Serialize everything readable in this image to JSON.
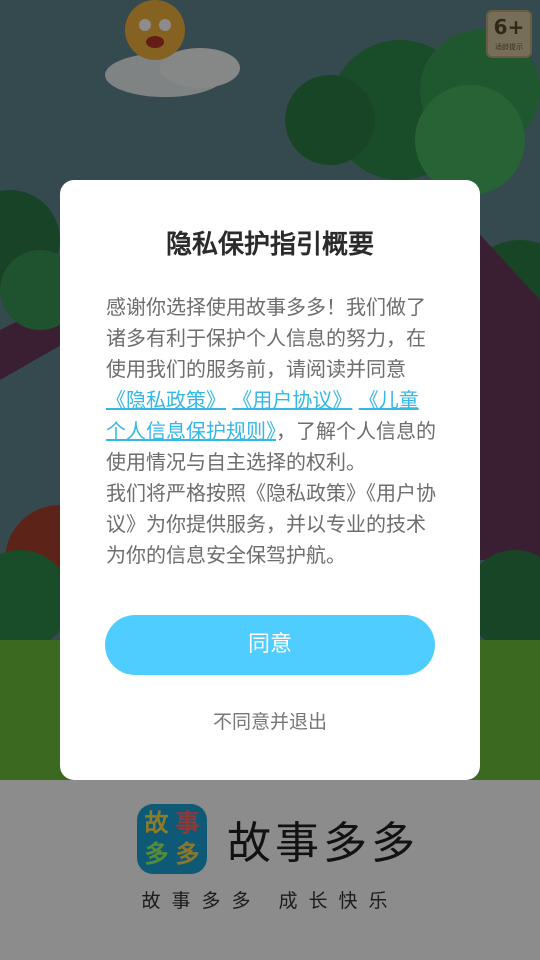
{
  "age_rating": {
    "label": "6+",
    "sub": "适龄提示"
  },
  "dialog": {
    "title": "隐私保护指引概要",
    "para1_before": "感谢你选择使用故事多多！我们做了诸多有利于保护个人信息的努力，在使用我们的服务前，请阅读并同意",
    "link_privacy": "《隐私政策》",
    "link_user": "《用户协议》",
    "link_children": "《儿童个人信息保护规则》",
    "para1_after": "，了解个人信息的使用情况与自主选择的权利。",
    "para2": "我们将严格按照《隐私政策》《用户协议》为你提供服务，并以专业的技术为你的信息安全保驾护航。",
    "agree_label": "同意",
    "disagree_label": "不同意并退出"
  },
  "footer": {
    "icon_chars": [
      "故",
      "事",
      "多",
      "多"
    ],
    "app_name": "故事多多",
    "slogan": "故事多多 成长快乐"
  },
  "colors": {
    "accent": "#4fcdff",
    "link": "#35b8e8"
  }
}
